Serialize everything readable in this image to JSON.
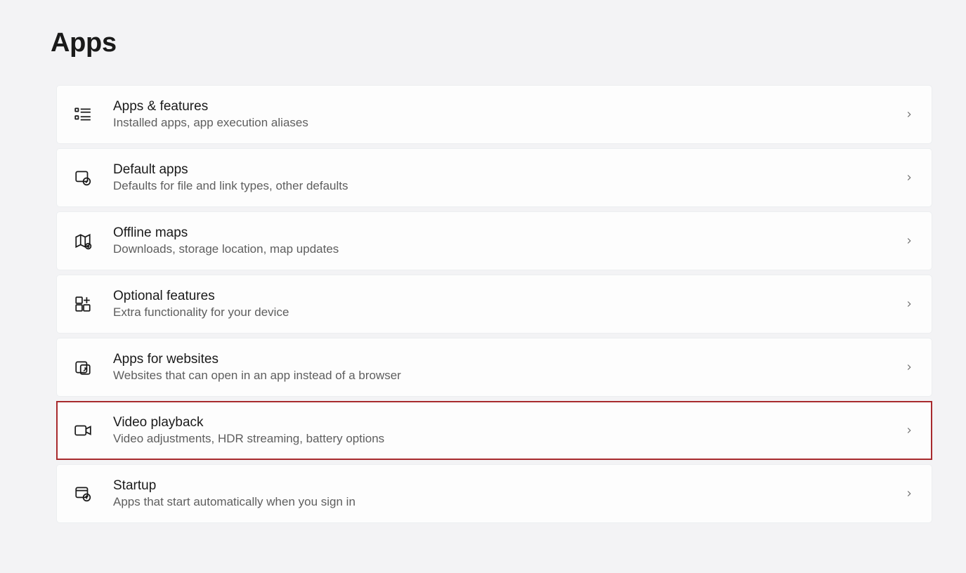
{
  "page": {
    "title": "Apps"
  },
  "items": [
    {
      "title": "Apps & features",
      "subtitle": "Installed apps, app execution aliases",
      "icon": "apps-list",
      "highlighted": false
    },
    {
      "title": "Default apps",
      "subtitle": "Defaults for file and link types, other defaults",
      "icon": "default-apps",
      "highlighted": false
    },
    {
      "title": "Offline maps",
      "subtitle": "Downloads, storage location, map updates",
      "icon": "map",
      "highlighted": false
    },
    {
      "title": "Optional features",
      "subtitle": "Extra functionality for your device",
      "icon": "grid-plus",
      "highlighted": false
    },
    {
      "title": "Apps for websites",
      "subtitle": "Websites that can open in an app instead of a browser",
      "icon": "website-app",
      "highlighted": false
    },
    {
      "title": "Video playback",
      "subtitle": "Video adjustments, HDR streaming, battery options",
      "icon": "video",
      "highlighted": true
    },
    {
      "title": "Startup",
      "subtitle": "Apps that start automatically when you sign in",
      "icon": "startup",
      "highlighted": false
    }
  ]
}
